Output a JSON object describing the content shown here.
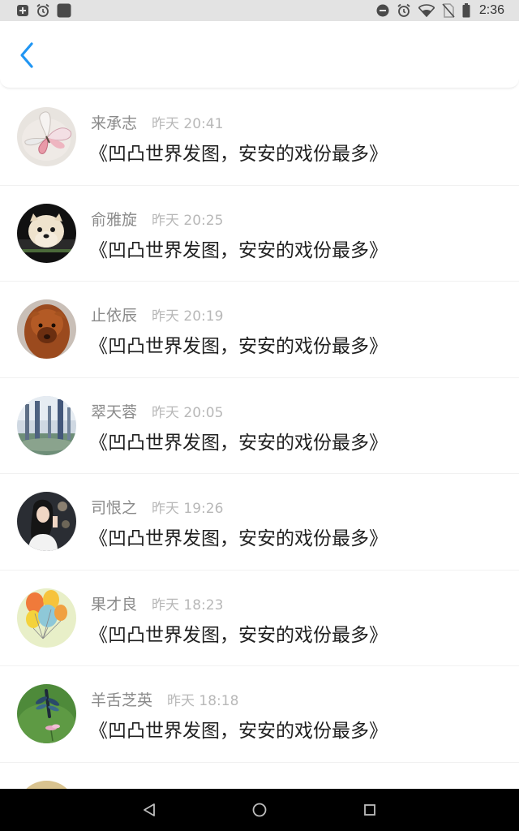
{
  "status_bar": {
    "time": "2:36",
    "left_icons": [
      "add-box-icon",
      "alarm-icon",
      "app-square-icon"
    ],
    "right_icons": [
      "do-not-disturb-icon",
      "alarm-icon",
      "wifi-icon",
      "no-sim-icon",
      "battery-icon"
    ]
  },
  "header": {
    "back_icon": "chevron-left-icon",
    "accent_color": "#2196F3"
  },
  "messages": [
    {
      "name": "来承志",
      "time": "昨天 20:41",
      "text": "《凹凸世界发图，安安的戏份最多》",
      "avatar": "butterfly-avatar"
    },
    {
      "name": "俞雅旋",
      "time": "昨天 20:25",
      "text": "《凹凸世界发图，安安的戏份最多》",
      "avatar": "dog-avatar"
    },
    {
      "name": "止依辰",
      "time": "昨天 20:19",
      "text": "《凹凸世界发图，安安的戏份最多》",
      "avatar": "alpaca-avatar"
    },
    {
      "name": "翠天蓉",
      "time": "昨天 20:05",
      "text": "《凹凸世界发图，安安的戏份最多》",
      "avatar": "forest-avatar"
    },
    {
      "name": "司恨之",
      "time": "昨天 19:26",
      "text": "《凹凸世界发图，安安的戏份最多》",
      "avatar": "woman-avatar"
    },
    {
      "name": "果才良",
      "time": "昨天 18:23",
      "text": "《凹凸世界发图，安安的戏份最多》",
      "avatar": "balloons-avatar"
    },
    {
      "name": "羊舌芝英",
      "time": "昨天 18:18",
      "text": "《凹凸世界发图，安安的戏份最多》",
      "avatar": "dragonfly-avatar"
    },
    {
      "name": "",
      "time": "",
      "text": "",
      "avatar": "partial-avatar"
    }
  ],
  "nav_bar": {
    "back_icon": "nav-back-icon",
    "home_icon": "nav-home-icon",
    "recents_icon": "nav-recents-icon"
  }
}
